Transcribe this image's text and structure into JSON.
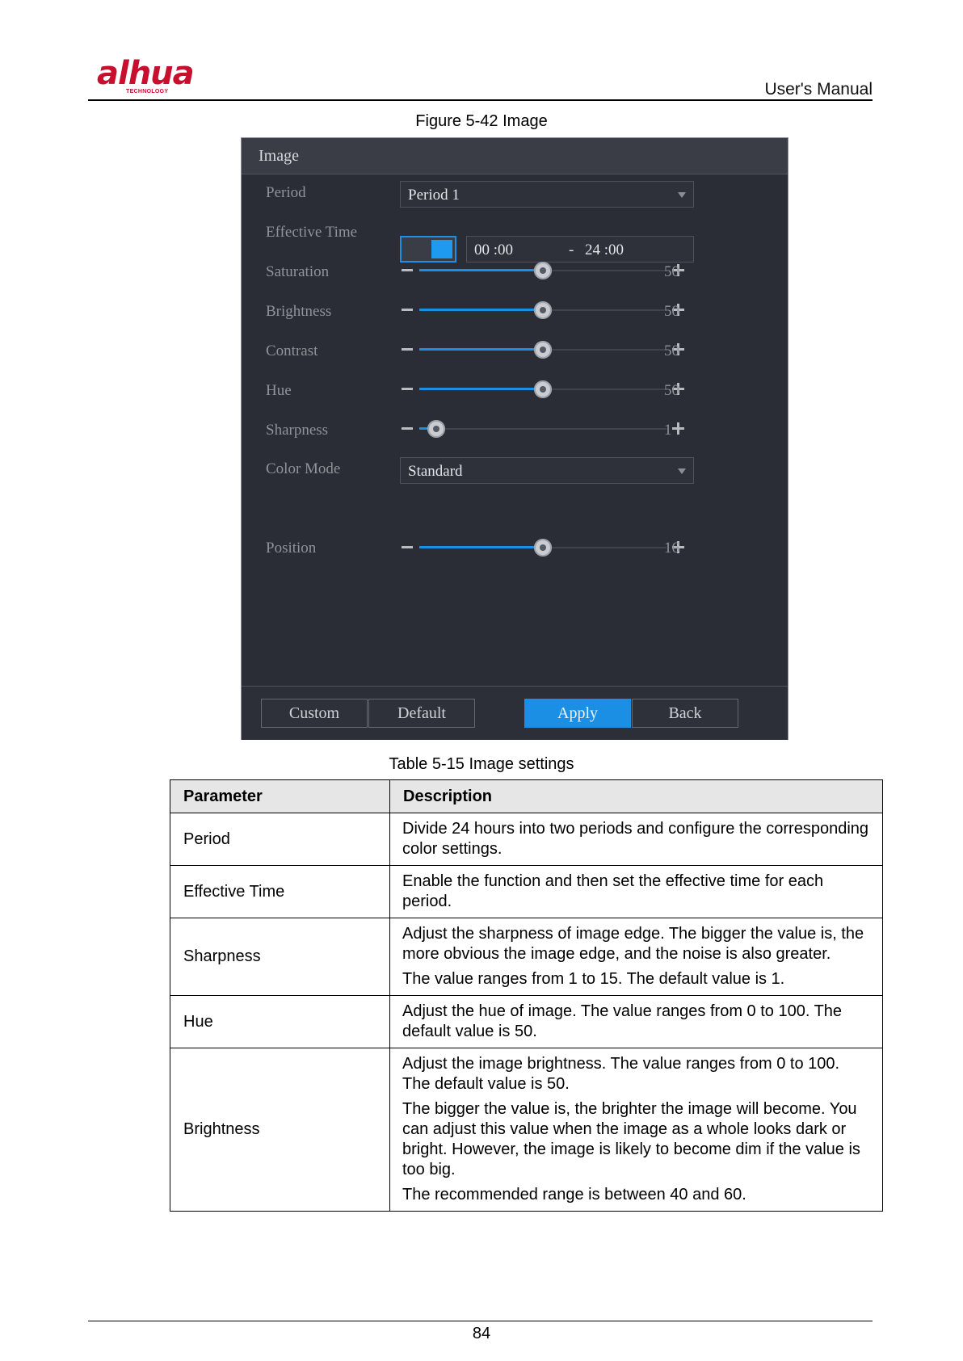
{
  "header": {
    "logo_text": "alhua",
    "logo_subtext": "TECHNOLOGY",
    "manual_label": "User's Manual"
  },
  "figure_caption": "Figure 5-42 Image",
  "panel": {
    "title": "Image",
    "period": {
      "label": "Period",
      "value": "Period 1"
    },
    "effective_time": {
      "label": "Effective Time",
      "enabled": true,
      "start": "00 :00",
      "separator": "-",
      "end": "24 :00"
    },
    "sliders": [
      {
        "label": "Saturation",
        "value": "50",
        "fraction": 0.5
      },
      {
        "label": "Brightness",
        "value": "50",
        "fraction": 0.5
      },
      {
        "label": "Contrast",
        "value": "50",
        "fraction": 0.5
      },
      {
        "label": "Hue",
        "value": "50",
        "fraction": 0.5
      },
      {
        "label": "Sharpness",
        "value": "1",
        "fraction": 0.07
      }
    ],
    "color_mode": {
      "label": "Color Mode",
      "value": "Standard"
    },
    "position": {
      "label": "Position",
      "value": "16",
      "fraction": 0.5
    },
    "buttons": {
      "custom": "Custom",
      "default": "Default",
      "apply": "Apply",
      "back": "Back"
    },
    "accent_color": "#1a8fe3"
  },
  "table_caption": "Table 5-15 Image settings",
  "table": {
    "headers": [
      "Parameter",
      "Description"
    ],
    "rows": [
      {
        "parameter": "Period",
        "description": [
          "Divide 24 hours into two periods and configure the corresponding color settings."
        ]
      },
      {
        "parameter": "Effective Time",
        "description": [
          "Enable the function and then set the effective time for each period."
        ]
      },
      {
        "parameter": "Sharpness",
        "description": [
          "Adjust the sharpness of image edge. The bigger the value is, the more obvious the image edge, and the noise is also greater.",
          "The value ranges from 1 to 15. The default value is 1."
        ]
      },
      {
        "parameter": "Hue",
        "description": [
          "Adjust the hue of image. The value ranges from 0 to 100. The default value is 50."
        ]
      },
      {
        "parameter": "Brightness",
        "description": [
          "Adjust the image brightness. The value ranges from 0 to 100. The default value is 50.",
          "The bigger the value is, the brighter the image will become. You can adjust this value when the image as a whole looks dark or bright. However, the image is likely to become dim if the value is too big.",
          "The recommended range is between 40 and 60."
        ]
      }
    ]
  },
  "page_number": "84"
}
